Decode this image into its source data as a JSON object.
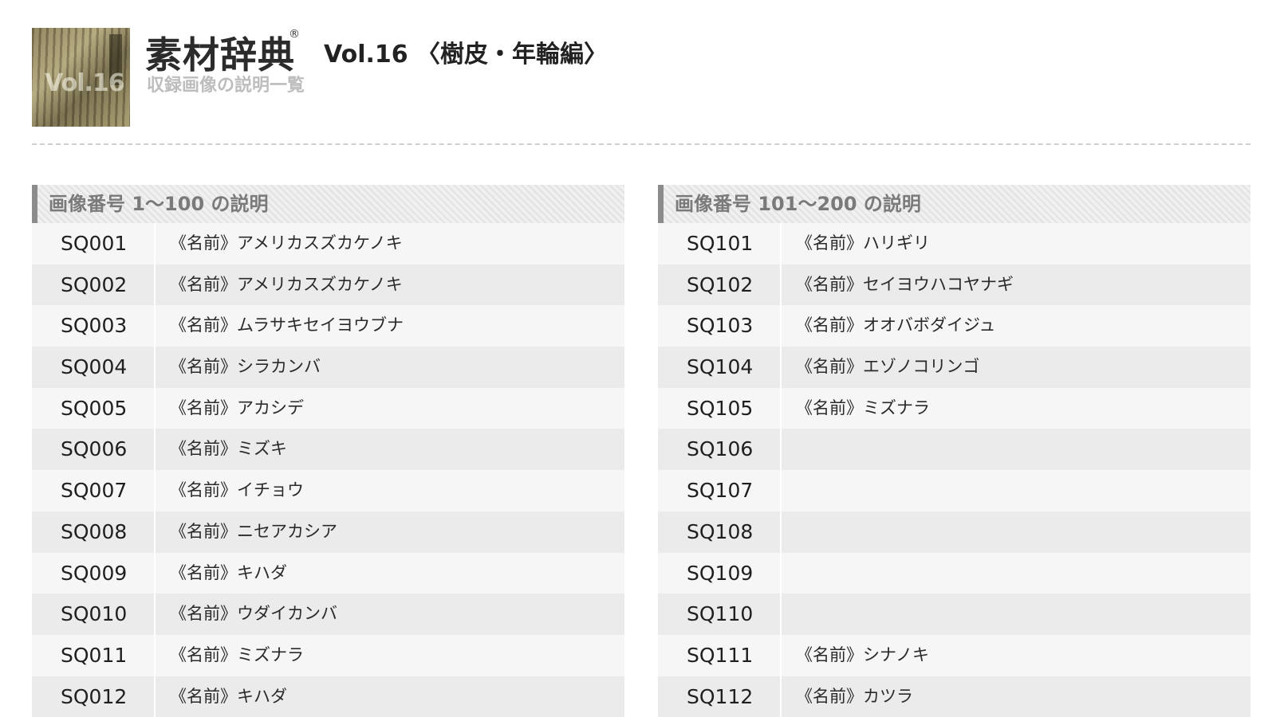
{
  "header": {
    "brand": "素材辞典",
    "registered": "®",
    "volume_title": "Vol.16 〈樹皮・年輪編〉",
    "subtitle": "収録画像の説明一覧",
    "cover_text": "Vol.16"
  },
  "panels": [
    {
      "title": "画像番号 1〜100 の説明",
      "rows": [
        {
          "code": "SQ001",
          "name": "《名前》アメリカスズカケノキ"
        },
        {
          "code": "SQ002",
          "name": "《名前》アメリカスズカケノキ"
        },
        {
          "code": "SQ003",
          "name": "《名前》ムラサキセイヨウブナ"
        },
        {
          "code": "SQ004",
          "name": "《名前》シラカンバ"
        },
        {
          "code": "SQ005",
          "name": "《名前》アカシデ"
        },
        {
          "code": "SQ006",
          "name": "《名前》ミズキ"
        },
        {
          "code": "SQ007",
          "name": "《名前》イチョウ"
        },
        {
          "code": "SQ008",
          "name": "《名前》ニセアカシア"
        },
        {
          "code": "SQ009",
          "name": "《名前》キハダ"
        },
        {
          "code": "SQ010",
          "name": "《名前》ウダイカンバ"
        },
        {
          "code": "SQ011",
          "name": "《名前》ミズナラ"
        },
        {
          "code": "SQ012",
          "name": "《名前》キハダ"
        }
      ]
    },
    {
      "title": "画像番号 101〜200 の説明",
      "rows": [
        {
          "code": "SQ101",
          "name": "《名前》ハリギリ"
        },
        {
          "code": "SQ102",
          "name": "《名前》セイヨウハコヤナギ"
        },
        {
          "code": "SQ103",
          "name": "《名前》オオバボダイジュ"
        },
        {
          "code": "SQ104",
          "name": "《名前》エゾノコリンゴ"
        },
        {
          "code": "SQ105",
          "name": "《名前》ミズナラ"
        },
        {
          "code": "SQ106",
          "name": ""
        },
        {
          "code": "SQ107",
          "name": ""
        },
        {
          "code": "SQ108",
          "name": ""
        },
        {
          "code": "SQ109",
          "name": ""
        },
        {
          "code": "SQ110",
          "name": ""
        },
        {
          "code": "SQ111",
          "name": "《名前》シナノキ"
        },
        {
          "code": "SQ112",
          "name": "《名前》カツラ"
        }
      ]
    }
  ]
}
